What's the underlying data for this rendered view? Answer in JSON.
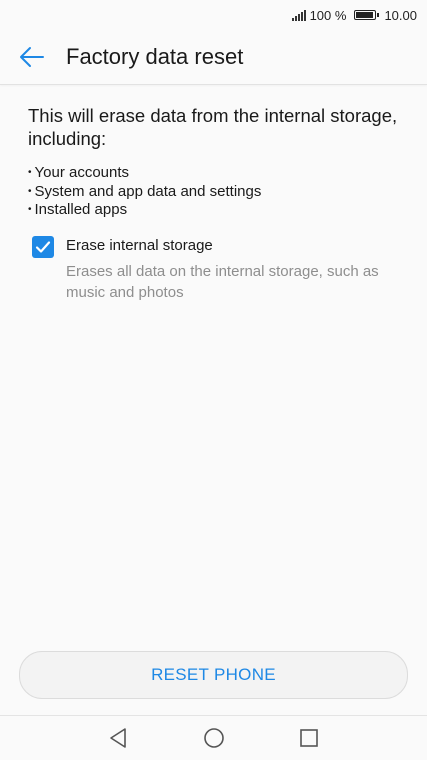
{
  "status_bar": {
    "battery_percent": "100 %",
    "battery_level": 1.0,
    "time": "10.00"
  },
  "header": {
    "title": "Factory data reset"
  },
  "content": {
    "intro": "This will erase data from the internal storage, including:",
    "items": [
      "Your accounts",
      "System and app data and settings",
      "Installed apps"
    ],
    "option": {
      "label": "Erase internal storage",
      "description": "Erases all data on the internal storage, such as music and photos",
      "checked": true
    }
  },
  "action": {
    "reset_label": "RESET PHONE"
  },
  "colors": {
    "accent": "#1e88e5"
  },
  "nav": {
    "icons": [
      "back-icon",
      "home-icon",
      "recents-icon"
    ]
  }
}
